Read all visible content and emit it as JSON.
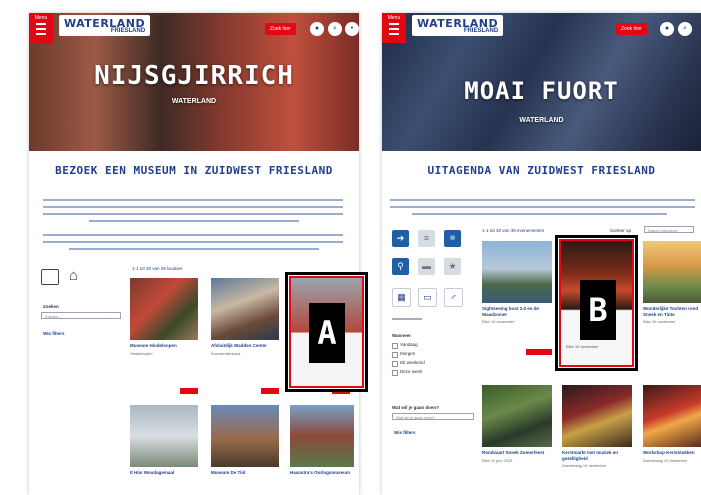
{
  "left": {
    "menu_label": "Menu",
    "logo_name": "WATERLAND",
    "logo_sub": "FRIESLAND",
    "search_button": "Zoek hier",
    "hero_title": "NIJSGJIRRICH",
    "hero_sub": "WATERLAND",
    "section_title": "BEZOEK EEN MUSEUM IN ZUIDWEST FRIESLAND",
    "filter_label": "Zoeken",
    "filter_placeholder": "Zoeken...",
    "reset_label": "Wis filters",
    "result_count": "1-1 tot 30 van 29 locaties",
    "cards": [
      {
        "title": "Museum Hindeloopen",
        "sub": "Hindeloopen"
      },
      {
        "title": "Afsluitdijk Wadden Center",
        "sub": "Kornwerderzand"
      },
      {
        "title": "",
        "sub": ""
      },
      {
        "title": "It Hûs Woudagemaal",
        "sub": ""
      },
      {
        "title": "Museum De Tiid",
        "sub": ""
      },
      {
        "title": "Haanstra's Oorlogsmuseum",
        "sub": ""
      }
    ],
    "marker": "A"
  },
  "right": {
    "menu_label": "Menu",
    "logo_name": "WATERLAND",
    "logo_sub": "FRIESLAND",
    "search_button": "Zoek hier",
    "hero_title": "MOAI FUORT",
    "hero_sub": "WATERLAND",
    "section_title": "UITAGENDA VAN ZUIDWEST FRIESLAND",
    "result_count": "1-1 tot 30 van 38 evenementen",
    "sort_label": "Sorteer op",
    "sort_value": "Datum oplopend",
    "wanneer_label": "Wanneer",
    "wanneer_options": [
      "Vandaag",
      "Morgen",
      "Dit weekend",
      "Deze week"
    ],
    "zoek_label": "Wat wil je gaan doen?",
    "zoek_placeholder": "Wat wil je gaan doen?",
    "reset_label": "Wis filters",
    "cards": [
      {
        "title": "Sightseeing boot 2.0 en de Waadzomer",
        "sub": "Elke 10 november"
      },
      {
        "title": "",
        "sub": "Elke 10 november"
      },
      {
        "title": "Wonderlijke Tochten rond Sneek en Tinte",
        "sub": "Elke 10 november"
      },
      {
        "title": "Rondvaart Sneek Zomerfeest",
        "sub": "Elke 11 juni 2025"
      },
      {
        "title": "Kerstmarkt met muziek en gezelligheid",
        "sub": "Donderdag 19 december"
      },
      {
        "title": "Workshop Kerststukken",
        "sub": "Donderdag 19 december"
      }
    ],
    "marker": "B"
  }
}
